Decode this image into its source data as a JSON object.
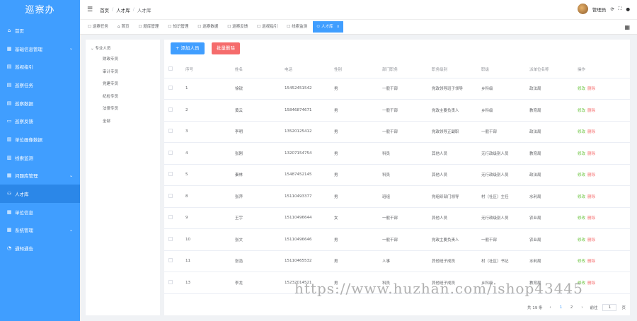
{
  "sidebar": {
    "title": "巡察办",
    "items": [
      {
        "label": "首页",
        "icon": "home-icon",
        "arrow": ""
      },
      {
        "label": "基础信息管理",
        "icon": "grid-icon",
        "arrow": "⌄"
      },
      {
        "label": "巡视指引",
        "icon": "doc-icon",
        "arrow": ""
      },
      {
        "label": "巡察任务",
        "icon": "doc-icon",
        "arrow": ""
      },
      {
        "label": "巡察数据",
        "icon": "doc-icon",
        "arrow": ""
      },
      {
        "label": "巡察反馈",
        "icon": "chat-icon",
        "arrow": ""
      },
      {
        "label": "单位画像数据",
        "icon": "chart-icon",
        "arrow": ""
      },
      {
        "label": "线索监测",
        "icon": "chart-icon",
        "arrow": ""
      },
      {
        "label": "问题库管理",
        "icon": "grid-icon",
        "arrow": "⌄"
      },
      {
        "label": "人才库",
        "icon": "user-icon",
        "arrow": "",
        "active": true
      },
      {
        "label": "单位信息",
        "icon": "grid-icon",
        "arrow": ""
      },
      {
        "label": "系统管理",
        "icon": "grid-icon",
        "arrow": "⌄"
      },
      {
        "label": "通知通告",
        "icon": "bell-icon",
        "arrow": ""
      }
    ]
  },
  "topbar": {
    "breadcrumb": [
      "首页",
      "人才库",
      "人才库"
    ],
    "separator": "/",
    "user": "管理员"
  },
  "tags": [
    {
      "label": "巡察任务",
      "icon": "☐"
    },
    {
      "label": "首页",
      "icon": "⌂"
    },
    {
      "label": "题库管理",
      "icon": "☐"
    },
    {
      "label": "知识管理",
      "icon": "☐"
    },
    {
      "label": "巡察数据",
      "icon": "☐"
    },
    {
      "label": "巡察反馈",
      "icon": "☐"
    },
    {
      "label": "巡视指引",
      "icon": "☐"
    },
    {
      "label": "线索监测",
      "icon": "☐"
    },
    {
      "label": "人才库",
      "icon": "⚇",
      "active": true,
      "close": "×"
    }
  ],
  "tree": {
    "root": "专业人员",
    "caret": "⌄",
    "children": [
      "财政专员",
      "审计专员",
      "党建专员",
      "纪检专员",
      "法律专员",
      "全部"
    ]
  },
  "toolbar": {
    "add_label": "+ 添加人员",
    "batch_delete_label": "批量删除"
  },
  "table": {
    "headers": [
      "",
      "序号",
      "姓名",
      "电话",
      "性别",
      "部门职务",
      "职务级别",
      "职级",
      "派单位名称",
      "操作"
    ],
    "rows": [
      [
        "1",
        "徐锐",
        "15452451542",
        "男",
        "一般干部",
        "党政领导班子领导",
        "乡科级",
        "政法局"
      ],
      [
        "2",
        "黄云",
        "15846874671",
        "男",
        "一般干部",
        "党政主要负责人",
        "乡科级",
        "教育局"
      ],
      [
        "3",
        "李明",
        "13520125412",
        "男",
        "一般干部",
        "党政领导正副职",
        "一般干部",
        "政法局"
      ],
      [
        "4",
        "张刚",
        "13207154754",
        "男",
        "科员",
        "其他人员",
        "无行政级别人员",
        "教育局"
      ],
      [
        "5",
        "秦林",
        "15487452145",
        "男",
        "科员",
        "其他人员",
        "无行政级别人员",
        "政法局"
      ],
      [
        "8",
        "张萍",
        "15110493377",
        "男",
        "班组",
        "党组织部门领导",
        "村（社区）主任",
        "水利局"
      ],
      [
        "9",
        "王宇",
        "15110496644",
        "女",
        "一般干部",
        "其他人员",
        "无行政级别人员",
        "农业局"
      ],
      [
        "10",
        "张文",
        "15110496646",
        "男",
        "一般干部",
        "党政主要负责人",
        "一般干部",
        "农业局"
      ],
      [
        "11",
        "张浩",
        "15110465532",
        "男",
        "人事",
        "其他班子成员",
        "村（社区）书记",
        "水利局"
      ],
      [
        "13",
        "李龙",
        "15232014521",
        "男",
        "科员",
        "其他班子成员",
        "乡科级",
        "教育局"
      ]
    ],
    "edit_label": "修改",
    "delete_label": "删除"
  },
  "pager": {
    "total": "共 19 条",
    "prev": "‹",
    "pages": [
      "1",
      "2"
    ],
    "current": "1",
    "next": "›",
    "goto_prefix": "前往",
    "goto_value": "1",
    "goto_suffix": "页"
  },
  "watermark": "https://www.huzhan.com/ishop43445",
  "colors": {
    "sidebar": "#409eff",
    "primary": "#409eff",
    "danger": "#f56c6c",
    "success": "#67c23a"
  }
}
